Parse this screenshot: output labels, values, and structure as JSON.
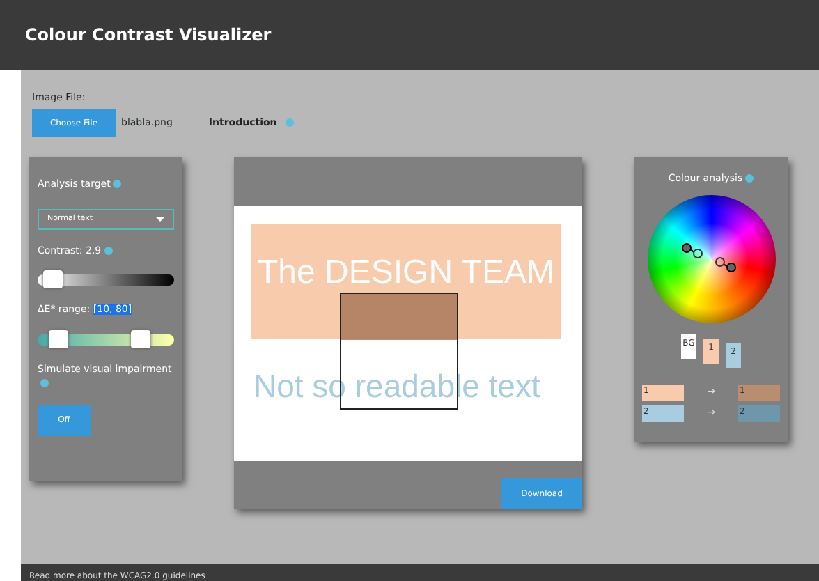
{
  "header": {
    "title": "Colour Contrast Visualizer"
  },
  "file": {
    "label": "Image File:",
    "button": "Choose File",
    "filename": "blabla.png",
    "intro_link": "Introduction"
  },
  "left_panel": {
    "analysis_label": "Analysis target",
    "target_select": "Normal text",
    "contrast_label": "Contrast: 2.9",
    "contrast_slider": {
      "level": 0.05
    },
    "delta_label": "ΔE* range:",
    "delta_value": "[10, 80]",
    "delta_slider": {
      "low": {
        "level": 0.1
      },
      "high": {
        "level": 0.8
      }
    },
    "simulate_label": "Simulate visual impairment",
    "simulate_button": "Off"
  },
  "preview": {
    "heading": "The DESIGN TEAM",
    "text": "Not so readable text",
    "download": "Download"
  },
  "right_panel": {
    "title": "Colour analysis",
    "swatches": [
      {
        "label": "BG",
        "color": "#ffffff"
      },
      {
        "label": "1",
        "color": "#f7cbab"
      },
      {
        "label": "2",
        "color": "#a8cde0"
      }
    ],
    "mappings": [
      {
        "from": {
          "label": "1",
          "color": "#f7cbab"
        },
        "arrow": "→",
        "to": {
          "label": "1",
          "color": "#b98d70"
        }
      },
      {
        "from": {
          "label": "2",
          "color": "#a8cde0"
        },
        "arrow": "→",
        "to": {
          "label": "2",
          "color": "#6f97ab"
        }
      }
    ]
  },
  "footer": {
    "text": "Read more about the WCAG2.0 guidelines"
  }
}
